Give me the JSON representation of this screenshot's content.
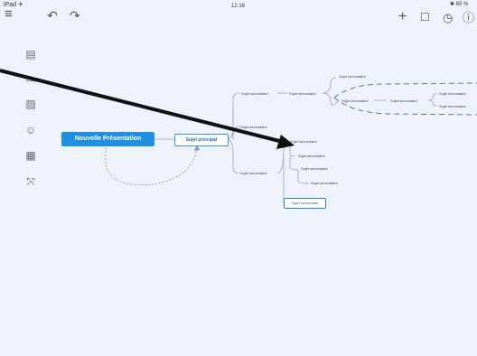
{
  "status_bar": {
    "carrier": "iPad ✈",
    "time": "12:16",
    "battery": "✱ 65 %"
  },
  "toolbar": {
    "menu_icon": "≡",
    "undo_icon": "↶",
    "redo_icon": "↷",
    "add_icon": "+",
    "edit_icon": "☐",
    "theme_icon": "◷",
    "info_icon": "ⓘ"
  },
  "sidebar": {
    "icons": [
      "▤",
      "▭",
      "▨",
      "☺",
      "▦",
      "⤧"
    ]
  },
  "mindmap": {
    "root": "Nouvelle Présentation",
    "main_topic": "Sujet principal",
    "branch_1": "Sujet secondaire",
    "branch_1_child": "Sujet secondaire",
    "branch_1_grandchild_top": "Sujet secondaire",
    "branch_1_grandchild_mid": "Sujet secondaire",
    "boundary_child": "Sujet secondaire",
    "boundary_right_top": "Sujet secondaire",
    "boundary_right_bottom": "Sujet secondaire",
    "branch_2": "Sujet secondaire",
    "branch_3": "Sujet secondaire",
    "branch_3_child_1": "Sujet secondaire",
    "branch_3_child_2": "Sujet secondaire",
    "branch_3_child_3": "Sujet secondaire",
    "branch_3_child_4": "Sujet secondaire",
    "selected_node": "Sujet secondaire"
  },
  "colors": {
    "background": "#eef2fb",
    "root_fill": "#1f8fe0",
    "accent": "#2b7fd3",
    "arrow": "#111111"
  }
}
